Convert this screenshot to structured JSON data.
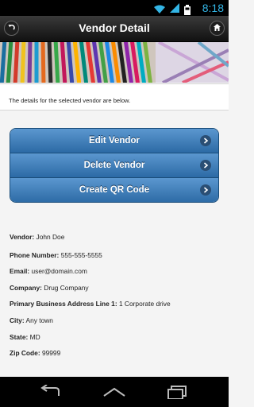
{
  "status_bar": {
    "time": "8:18",
    "icons": [
      "wifi-icon",
      "signal-icon",
      "battery-icon"
    ]
  },
  "header": {
    "title": "Vendor Detail",
    "back_icon": "back-icon",
    "home_icon": "home-icon"
  },
  "info_text": "The details for the selected vendor are below.",
  "actions": [
    {
      "label": "Edit Vendor"
    },
    {
      "label": "Delete Vendor"
    },
    {
      "label": "Create QR Code"
    }
  ],
  "vendor": {
    "name_label": "Vendor:",
    "name": "John Doe",
    "phone_label": "Phone Number:",
    "phone": "555-555-5555",
    "email_label": "Email:",
    "email": "user@domain.com",
    "company_label": "Company:",
    "company": "Drug Company",
    "address_label": "Primary Business Address Line 1:",
    "address": "1 Corporate drive",
    "city_label": "City:",
    "city": "Any town",
    "state_label": "State:",
    "state": "MD",
    "zip_label": "Zip Code:",
    "zip": "99999"
  },
  "colors": {
    "button_top": "#5b97cf",
    "button_bottom": "#2c6aa5",
    "clock": "#33b5e5"
  }
}
